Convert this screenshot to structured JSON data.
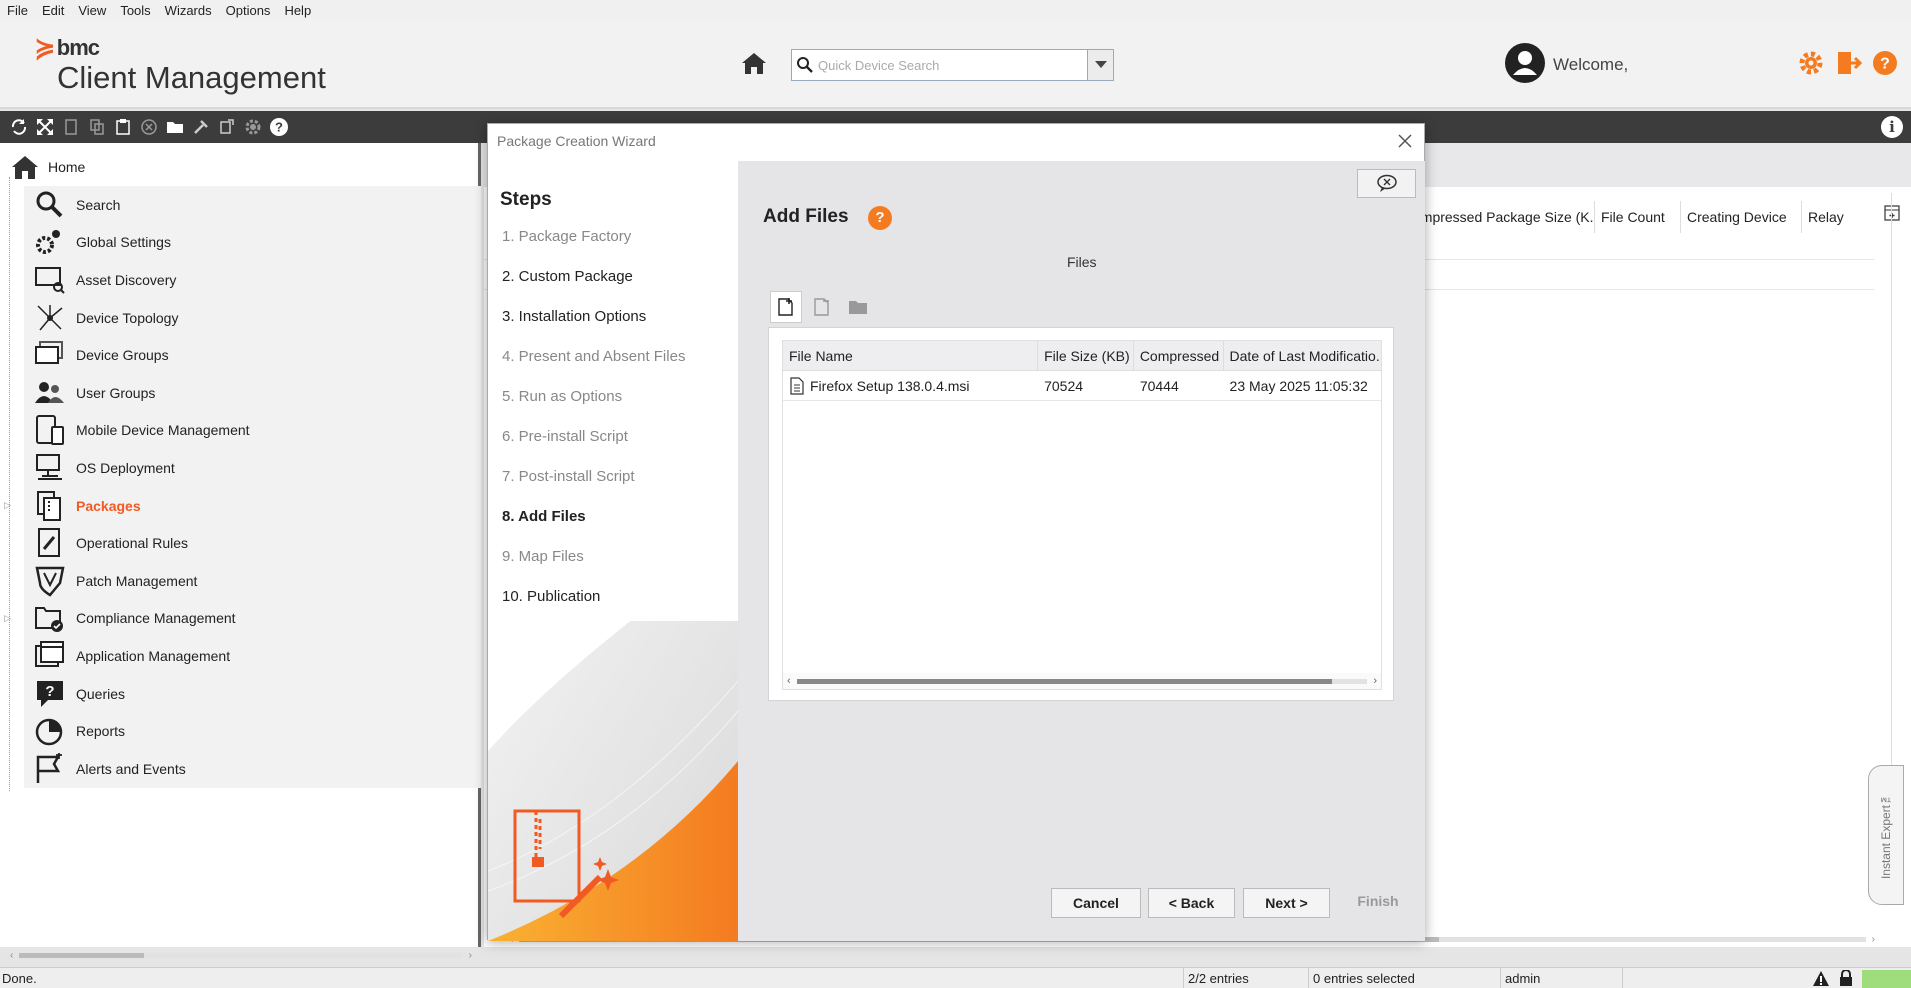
{
  "menu": [
    "File",
    "Edit",
    "View",
    "Tools",
    "Wizards",
    "Options",
    "Help"
  ],
  "header": {
    "brand": "bmc",
    "product": "Client Management",
    "search_placeholder": "Quick Device Search",
    "welcome": "Welcome,"
  },
  "nav": {
    "home": "Home",
    "items": [
      {
        "label": "Search",
        "icon": "magnifier-icon"
      },
      {
        "label": "Global Settings",
        "icon": "gears-icon"
      },
      {
        "label": "Asset Discovery",
        "icon": "monitor-search-icon"
      },
      {
        "label": "Device Topology",
        "icon": "topology-icon"
      },
      {
        "label": "Device Groups",
        "icon": "monitors-icon"
      },
      {
        "label": "User Groups",
        "icon": "users-icon"
      },
      {
        "label": "Mobile Device Management",
        "icon": "mobile-icon"
      },
      {
        "label": "OS Deployment",
        "icon": "os-deploy-icon"
      },
      {
        "label": "Packages",
        "icon": "packages-icon",
        "active": true
      },
      {
        "label": "Operational Rules",
        "icon": "rules-icon"
      },
      {
        "label": "Patch Management",
        "icon": "shield-icon"
      },
      {
        "label": "Compliance Management",
        "icon": "compliance-icon"
      },
      {
        "label": "Application Management",
        "icon": "windows-icon"
      },
      {
        "label": "Queries",
        "icon": "query-icon"
      },
      {
        "label": "Reports",
        "icon": "pie-icon"
      },
      {
        "label": "Alerts and Events",
        "icon": "alert-flag-icon"
      }
    ]
  },
  "bg_table": {
    "columns": [
      "ompressed Package Size (K...",
      "File Count",
      "Creating Device",
      "Relay"
    ]
  },
  "instant_expert": "Instant Expert™",
  "wizard": {
    "title": "Package Creation Wizard",
    "steps_title": "Steps",
    "steps": [
      {
        "label": "1. Package Factory",
        "state": "disabled"
      },
      {
        "label": "2. Custom Package",
        "state": "done"
      },
      {
        "label": "3. Installation Options",
        "state": "done"
      },
      {
        "label": "4. Present and Absent Files",
        "state": "disabled"
      },
      {
        "label": "5. Run as Options",
        "state": "disabled"
      },
      {
        "label": "6. Pre-install Script",
        "state": "disabled"
      },
      {
        "label": "7. Post-install Script",
        "state": "disabled"
      },
      {
        "label": "8. Add Files",
        "state": "current"
      },
      {
        "label": "9. Map Files",
        "state": "disabled"
      },
      {
        "label": "10. Publication",
        "state": "done"
      }
    ],
    "page_title": "Add Files",
    "help": "?",
    "files_label": "Files",
    "table": {
      "columns": [
        "File Name",
        "File Size (KB)",
        "Compressed",
        "Date of Last Modificatio..."
      ],
      "rows": [
        {
          "name": "Firefox Setup 138.0.4.msi",
          "size": "70524",
          "compressed": "70444",
          "modified": "23 May 2025 11:05:32"
        }
      ]
    },
    "buttons": {
      "cancel": "Cancel",
      "back": "< Back",
      "next": "Next >",
      "finish": "Finish"
    }
  },
  "status": {
    "left": "Done.",
    "entries": "2/2 entries",
    "selected": "0 entries selected",
    "user": "admin"
  },
  "colors": {
    "accent": "#f15a22",
    "toolbar": "#3c3c3c",
    "help": "#f47b20",
    "status_ok": "#9fdc7c"
  }
}
